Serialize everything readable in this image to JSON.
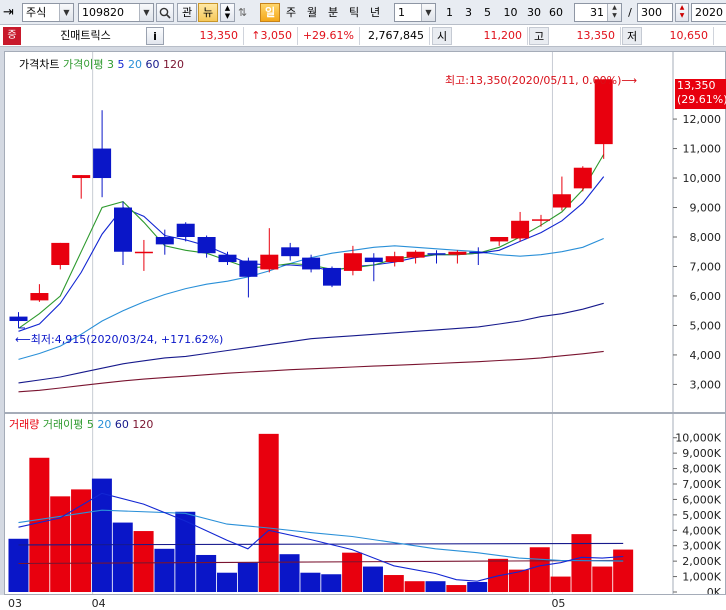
{
  "toolbar": {
    "market": "주식",
    "code": "109820",
    "btn_gwan": "관",
    "btn_new": "뉴",
    "period_buttons": [
      "일",
      "주",
      "월",
      "분",
      "틱",
      "년"
    ],
    "interval_value": "1",
    "quick_intervals": [
      "1",
      "3",
      "5",
      "10",
      "30",
      "60"
    ],
    "count_value": "31",
    "count_sep": "/",
    "total_value": "300",
    "date_value": "2020"
  },
  "info": {
    "badge": "증",
    "name": "진매트릭스",
    "info_icon": "i",
    "price": "13,350",
    "change": "↑3,050",
    "rate": "+29.61%",
    "volume": "2,767,845",
    "open_label": "시",
    "open": "11,200",
    "high_label": "고",
    "high": "13,350",
    "low_label": "저",
    "low": "10,650"
  },
  "price_pane": {
    "legend": [
      "가격차트",
      "가격이평",
      "3",
      "5",
      "20",
      "60",
      "120"
    ],
    "high_annotation": "최고:13,350(2020/05/11, 0.00%)⟶",
    "low_annotation": "⟵최저:4,915(2020/03/24, +171.62%)",
    "current_tag": [
      "13,350",
      "(29.61%)"
    ]
  },
  "volume_pane": {
    "legend": [
      "거래량",
      "거래이평",
      "5",
      "20",
      "60",
      "120"
    ]
  },
  "colors": {
    "up": "#e8000e",
    "down": "#0a16c8",
    "ma3": "#2e9a2e",
    "ma5": "#1226d2",
    "ma20": "#2a90d8",
    "ma60": "#171a8c",
    "ma120": "#7a1430"
  },
  "chart_data": {
    "type": "candlestick",
    "x_tick_labels": [
      "03",
      "04",
      "05"
    ],
    "price_axis": {
      "ticks": [
        "3,000",
        "4,000",
        "5,000",
        "6,000",
        "7,000",
        "8,000",
        "9,000",
        "10,000",
        "11,000",
        "12,000"
      ],
      "range": [
        2200,
        13800
      ]
    },
    "volume_axis": {
      "ticks": [
        "0K",
        "1,000K",
        "2,000K",
        "3,000K",
        "4,000K",
        "5,000K",
        "6,000K",
        "7,000K",
        "8,000K",
        "9,000K",
        "10,000K"
      ],
      "range": [
        0,
        10500
      ]
    },
    "candles": [
      {
        "o": 5300,
        "h": 5450,
        "l": 4915,
        "c": 5150
      },
      {
        "o": 5850,
        "h": 6400,
        "l": 5800,
        "c": 6100
      },
      {
        "o": 7050,
        "h": 7800,
        "l": 6900,
        "c": 7800
      },
      {
        "o": 10000,
        "h": 10100,
        "l": 9300,
        "c": 10100
      },
      {
        "o": 11000,
        "h": 12300,
        "l": 9350,
        "c": 10000
      },
      {
        "o": 9000,
        "h": 9200,
        "l": 7050,
        "c": 7500
      },
      {
        "o": 7450,
        "h": 7900,
        "l": 6850,
        "c": 7500
      },
      {
        "o": 8000,
        "h": 8250,
        "l": 7400,
        "c": 7750
      },
      {
        "o": 8450,
        "h": 8500,
        "l": 7850,
        "c": 8000
      },
      {
        "o": 8000,
        "h": 8050,
        "l": 7300,
        "c": 7450
      },
      {
        "o": 7400,
        "h": 7500,
        "l": 7050,
        "c": 7150
      },
      {
        "o": 7200,
        "h": 7300,
        "l": 5950,
        "c": 6650
      },
      {
        "o": 6900,
        "h": 8300,
        "l": 6800,
        "c": 7400
      },
      {
        "o": 7650,
        "h": 7800,
        "l": 7200,
        "c": 7350
      },
      {
        "o": 7300,
        "h": 7400,
        "l": 6800,
        "c": 6900
      },
      {
        "o": 6950,
        "h": 7000,
        "l": 6300,
        "c": 6350
      },
      {
        "o": 6850,
        "h": 7700,
        "l": 6700,
        "c": 7450
      },
      {
        "o": 7300,
        "h": 7450,
        "l": 6500,
        "c": 7150
      },
      {
        "o": 7150,
        "h": 7500,
        "l": 7000,
        "c": 7350
      },
      {
        "o": 7300,
        "h": 7550,
        "l": 7100,
        "c": 7500
      },
      {
        "o": 7450,
        "h": 7550,
        "l": 7100,
        "c": 7400
      },
      {
        "o": 7400,
        "h": 7550,
        "l": 7100,
        "c": 7500
      },
      {
        "o": 7500,
        "h": 7650,
        "l": 7050,
        "c": 7450
      },
      {
        "o": 7850,
        "h": 8000,
        "l": 7700,
        "c": 8000
      },
      {
        "o": 7950,
        "h": 8850,
        "l": 7850,
        "c": 8550
      },
      {
        "o": 8600,
        "h": 8750,
        "l": 8350,
        "c": 8600
      },
      {
        "o": 9000,
        "h": 10050,
        "l": 8900,
        "c": 9450
      },
      {
        "o": 9650,
        "h": 10400,
        "l": 9550,
        "c": 10350
      },
      {
        "o": 11150,
        "h": 13350,
        "l": 10650,
        "c": 13350
      }
    ],
    "volumes_k": [
      3450,
      8700,
      6200,
      6650,
      7350,
      4500,
      3950,
      2800,
      5200,
      2400,
      1250,
      1900,
      10250,
      2450,
      1250,
      1150,
      2550,
      1650,
      1100,
      700,
      700,
      450,
      650,
      2150,
      1450,
      2900,
      1000,
      3750,
      1650,
      2750
    ],
    "price_ma": {
      "ma3": [
        [
          0,
          4900
        ],
        [
          1,
          5400
        ],
        [
          2,
          6000
        ],
        [
          3,
          7500
        ],
        [
          4,
          9000
        ],
        [
          5,
          9200
        ],
        [
          6,
          8500
        ],
        [
          7,
          7700
        ],
        [
          8,
          7550
        ],
        [
          9,
          7450
        ],
        [
          10,
          7200
        ],
        [
          11,
          6950
        ],
        [
          12,
          7000
        ],
        [
          13,
          7100
        ],
        [
          14,
          7050
        ],
        [
          15,
          6900
        ],
        [
          16,
          6950
        ],
        [
          17,
          7050
        ],
        [
          18,
          7250
        ],
        [
          19,
          7350
        ],
        [
          20,
          7400
        ],
        [
          21,
          7400
        ],
        [
          22,
          7450
        ],
        [
          23,
          7650
        ],
        [
          24,
          8000
        ],
        [
          25,
          8400
        ],
        [
          26,
          8850
        ],
        [
          27,
          9600
        ],
        [
          28,
          10800
        ]
      ],
      "ma5": [
        [
          0,
          4800
        ],
        [
          1,
          5050
        ],
        [
          2,
          5750
        ],
        [
          3,
          6800
        ],
        [
          4,
          8100
        ],
        [
          5,
          9000
        ],
        [
          6,
          8700
        ],
        [
          7,
          8050
        ],
        [
          8,
          7900
        ],
        [
          9,
          7700
        ],
        [
          10,
          7400
        ],
        [
          11,
          7100
        ],
        [
          12,
          7050
        ],
        [
          13,
          7050
        ],
        [
          14,
          7000
        ],
        [
          15,
          6850
        ],
        [
          16,
          7000
        ],
        [
          17,
          7050
        ],
        [
          18,
          7150
        ],
        [
          19,
          7300
        ],
        [
          20,
          7400
        ],
        [
          21,
          7400
        ],
        [
          22,
          7450
        ],
        [
          23,
          7550
        ],
        [
          24,
          7850
        ],
        [
          25,
          8150
        ],
        [
          26,
          8550
        ],
        [
          27,
          9150
        ],
        [
          28,
          10050
        ]
      ],
      "ma20": [
        [
          0,
          3850
        ],
        [
          1,
          4050
        ],
        [
          2,
          4300
        ],
        [
          3,
          4700
        ],
        [
          4,
          5150
        ],
        [
          5,
          5500
        ],
        [
          6,
          5800
        ],
        [
          7,
          6050
        ],
        [
          8,
          6250
        ],
        [
          9,
          6400
        ],
        [
          10,
          6500
        ],
        [
          11,
          6650
        ],
        [
          12,
          6850
        ],
        [
          13,
          7100
        ],
        [
          14,
          7300
        ],
        [
          15,
          7450
        ],
        [
          16,
          7550
        ],
        [
          17,
          7650
        ],
        [
          18,
          7700
        ],
        [
          19,
          7650
        ],
        [
          20,
          7600
        ],
        [
          21,
          7550
        ],
        [
          22,
          7500
        ],
        [
          23,
          7400
        ],
        [
          24,
          7350
        ],
        [
          25,
          7400
        ],
        [
          26,
          7500
        ],
        [
          27,
          7650
        ],
        [
          28,
          7950
        ]
      ],
      "ma60": [
        [
          0,
          3050
        ],
        [
          1,
          3150
        ],
        [
          2,
          3250
        ],
        [
          3,
          3400
        ],
        [
          4,
          3550
        ],
        [
          5,
          3700
        ],
        [
          6,
          3800
        ],
        [
          7,
          3900
        ],
        [
          8,
          3950
        ],
        [
          9,
          4050
        ],
        [
          10,
          4150
        ],
        [
          11,
          4250
        ],
        [
          12,
          4350
        ],
        [
          13,
          4450
        ],
        [
          14,
          4550
        ],
        [
          15,
          4600
        ],
        [
          16,
          4650
        ],
        [
          17,
          4700
        ],
        [
          18,
          4750
        ],
        [
          19,
          4800
        ],
        [
          20,
          4850
        ],
        [
          21,
          4900
        ],
        [
          22,
          4950
        ],
        [
          23,
          5050
        ],
        [
          24,
          5150
        ],
        [
          25,
          5300
        ],
        [
          26,
          5400
        ],
        [
          27,
          5550
        ],
        [
          28,
          5750
        ]
      ],
      "ma120": [
        [
          0,
          2750
        ],
        [
          1,
          2800
        ],
        [
          2,
          2880
        ],
        [
          3,
          2960
        ],
        [
          4,
          3040
        ],
        [
          5,
          3120
        ],
        [
          6,
          3180
        ],
        [
          7,
          3230
        ],
        [
          8,
          3280
        ],
        [
          9,
          3330
        ],
        [
          10,
          3380
        ],
        [
          11,
          3420
        ],
        [
          12,
          3460
        ],
        [
          13,
          3500
        ],
        [
          14,
          3530
        ],
        [
          15,
          3560
        ],
        [
          16,
          3590
        ],
        [
          17,
          3620
        ],
        [
          18,
          3650
        ],
        [
          19,
          3680
        ],
        [
          20,
          3710
        ],
        [
          21,
          3740
        ],
        [
          22,
          3770
        ],
        [
          23,
          3810
        ],
        [
          24,
          3850
        ],
        [
          25,
          3900
        ],
        [
          26,
          3970
        ],
        [
          27,
          4040
        ],
        [
          28,
          4120
        ]
      ]
    },
    "volume_ma": {
      "ma5": [
        [
          0,
          4200
        ],
        [
          2,
          4800
        ],
        [
          4,
          6400
        ],
        [
          6,
          5700
        ],
        [
          8,
          4600
        ],
        [
          10,
          3350
        ],
        [
          11,
          2800
        ],
        [
          12,
          4000
        ],
        [
          14,
          3400
        ],
        [
          16,
          2750
        ],
        [
          18,
          1700
        ],
        [
          20,
          1200
        ],
        [
          21,
          800
        ],
        [
          22,
          700
        ],
        [
          23,
          1050
        ],
        [
          24,
          1300
        ],
        [
          25,
          1700
        ],
        [
          26,
          1900
        ],
        [
          27,
          2250
        ],
        [
          28,
          2200
        ],
        [
          29,
          2300
        ]
      ],
      "ma20": [
        [
          0,
          4500
        ],
        [
          4,
          5300
        ],
        [
          8,
          5100
        ],
        [
          10,
          4400
        ],
        [
          12,
          4150
        ],
        [
          14,
          3850
        ],
        [
          16,
          3600
        ],
        [
          18,
          3200
        ],
        [
          20,
          2800
        ],
        [
          22,
          2550
        ],
        [
          24,
          2200
        ],
        [
          26,
          2050
        ],
        [
          29,
          2000
        ]
      ],
      "ma60": [
        [
          0,
          3050
        ],
        [
          29,
          3150
        ]
      ],
      "ma120": [
        [
          0,
          1850
        ],
        [
          29,
          2050
        ]
      ]
    },
    "legend_position": "top-left"
  }
}
